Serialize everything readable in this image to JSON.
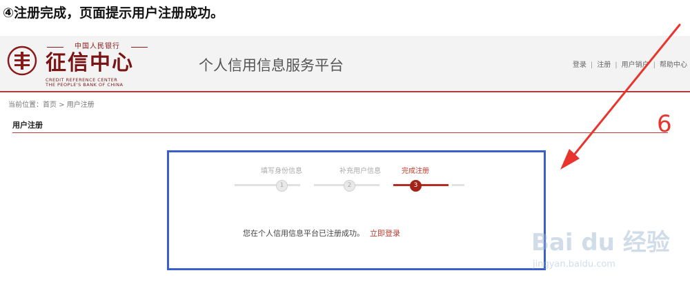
{
  "caption": "④注册完成，页面提示用户注册成功。",
  "header": {
    "logo": {
      "top_text": "中国人民银行",
      "main_text": "征信中心",
      "en_line1": "CREDIT REFERENCE CENTER",
      "en_line2": "THE PEOPLE'S BANK OF CHINA"
    },
    "platform_title": "个人信用信息服务平台",
    "nav": {
      "login": "登录",
      "register": "注册",
      "user_logout": "用户销户",
      "help": "帮助中心"
    },
    "accent_color": "#b0393a"
  },
  "breadcrumb": {
    "prefix": "当前位置：",
    "home": "首页",
    "separator": " > ",
    "current": "用户注册"
  },
  "section_title": "用户注册",
  "steps": [
    {
      "label": "填写身份信息",
      "number": "1",
      "active": false
    },
    {
      "label": "补充用户信息",
      "number": "2",
      "active": false
    },
    {
      "label": "完成注册",
      "number": "3",
      "active": true
    }
  ],
  "success": {
    "message": "您在个人信用信息平台已注册成功。",
    "login_link": "立即登录"
  },
  "annotation": {
    "number": "6",
    "arrow_color": "#e8342c",
    "box_color": "#3a5fcd"
  },
  "watermark": {
    "main": "Bai du 经验",
    "sub": "jingyan.baidu.com"
  }
}
